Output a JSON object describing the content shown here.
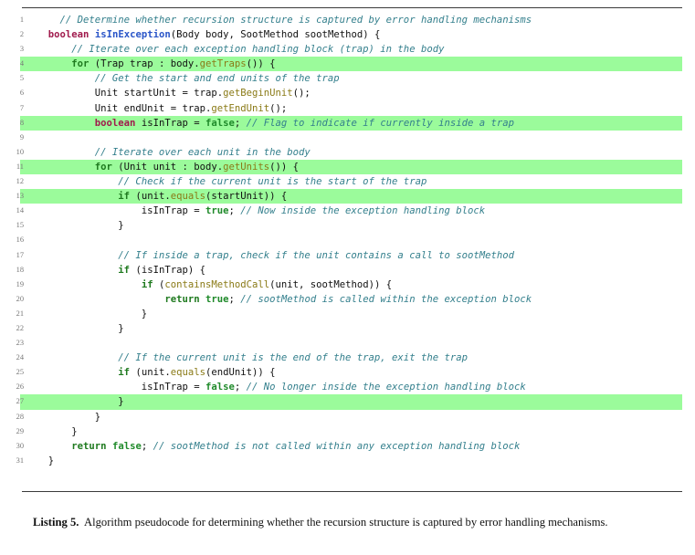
{
  "listing": {
    "label": "Listing 5.",
    "caption_text": "Algorithm pseudocode for determining whether the recursion structure is captured by error handling mechanisms.",
    "highlight_color": "#9bfb9b",
    "comment_color": "#337f8c",
    "keyword_color": "#a01a4c",
    "control_color": "#1f7a1f",
    "method_call_color": "#8a7a16",
    "declared_method_color": "#2a55c8",
    "literal_color": "#1f8a2a",
    "line_number_color": "#777777",
    "total_lines": 31,
    "lines": [
      {
        "n": "1",
        "highlight": false,
        "code": "    // Determine whether recursion structure is captured by error handling mechanisms"
      },
      {
        "n": "2",
        "highlight": false,
        "code": "  boolean isInException(Body body, SootMethod sootMethod) {"
      },
      {
        "n": "3",
        "highlight": false,
        "code": "      // Iterate over each exception handling block (trap) in the body"
      },
      {
        "n": "4",
        "highlight": true,
        "code": "      for (Trap trap : body.getTraps()) {"
      },
      {
        "n": "5",
        "highlight": false,
        "code": "          // Get the start and end units of the trap"
      },
      {
        "n": "6",
        "highlight": false,
        "code": "          Unit startUnit = trap.getBeginUnit();"
      },
      {
        "n": "7",
        "highlight": false,
        "code": "          Unit endUnit = trap.getEndUnit();"
      },
      {
        "n": "8",
        "highlight": true,
        "code": "          boolean isInTrap = false; // Flag to indicate if currently inside a trap"
      },
      {
        "n": "9",
        "highlight": false,
        "code": ""
      },
      {
        "n": "10",
        "highlight": false,
        "code": "          // Iterate over each unit in the body"
      },
      {
        "n": "11",
        "highlight": true,
        "code": "          for (Unit unit : body.getUnits()) {"
      },
      {
        "n": "12",
        "highlight": false,
        "code": "              // Check if the current unit is the start of the trap"
      },
      {
        "n": "13",
        "highlight": true,
        "code": "              if (unit.equals(startUnit)) {"
      },
      {
        "n": "14",
        "highlight": false,
        "code": "                  isInTrap = true; // Now inside the exception handling block"
      },
      {
        "n": "15",
        "highlight": false,
        "code": "              }"
      },
      {
        "n": "16",
        "highlight": false,
        "code": ""
      },
      {
        "n": "17",
        "highlight": false,
        "code": "              // If inside a trap, check if the unit contains a call to sootMethod"
      },
      {
        "n": "18",
        "highlight": false,
        "code": "              if (isInTrap) {"
      },
      {
        "n": "19",
        "highlight": false,
        "code": "                  if (containsMethodCall(unit, sootMethod)) {"
      },
      {
        "n": "20",
        "highlight": false,
        "code": "                      return true; // sootMethod is called within the exception block"
      },
      {
        "n": "21",
        "highlight": false,
        "code": "                  }"
      },
      {
        "n": "22",
        "highlight": false,
        "code": "              }"
      },
      {
        "n": "23",
        "highlight": false,
        "code": ""
      },
      {
        "n": "24",
        "highlight": false,
        "code": "              // If the current unit is the end of the trap, exit the trap"
      },
      {
        "n": "25",
        "highlight": false,
        "code": "              if (unit.equals(endUnit)) {"
      },
      {
        "n": "26",
        "highlight": false,
        "code": "                  isInTrap = false; // No longer inside the exception handling block"
      },
      {
        "n": "27",
        "highlight": true,
        "code": "              }"
      },
      {
        "n": "28",
        "highlight": false,
        "code": "          }"
      },
      {
        "n": "29",
        "highlight": false,
        "code": "      }"
      },
      {
        "n": "30",
        "highlight": false,
        "code": "      return false; // sootMethod is not called within any exception handling block"
      },
      {
        "n": "31",
        "highlight": false,
        "code": "  }"
      }
    ],
    "tokens": {
      "1": [
        [
          "cmt",
          "    // Determine whether recursion structure is captured by error handling mechanisms"
        ]
      ],
      "2": [
        [
          "plain",
          "  "
        ],
        [
          "kw",
          "boolean"
        ],
        [
          "plain",
          " "
        ],
        [
          "fn",
          "isInException"
        ],
        [
          "plain",
          "(Body body, SootMethod sootMethod) {"
        ]
      ],
      "3": [
        [
          "cmt",
          "      // Iterate over each exception handling block (trap) in the body"
        ]
      ],
      "4": [
        [
          "plain",
          "      "
        ],
        [
          "ctrl",
          "for"
        ],
        [
          "plain",
          " (Trap trap : body."
        ],
        [
          "call",
          "getTraps"
        ],
        [
          "plain",
          "()) {"
        ]
      ],
      "5": [
        [
          "cmt",
          "          // Get the start and end units of the trap"
        ]
      ],
      "6": [
        [
          "plain",
          "          Unit startUnit = trap."
        ],
        [
          "call",
          "getBeginUnit"
        ],
        [
          "plain",
          "();"
        ]
      ],
      "7": [
        [
          "plain",
          "          Unit endUnit = trap."
        ],
        [
          "call",
          "getEndUnit"
        ],
        [
          "plain",
          "();"
        ]
      ],
      "8": [
        [
          "plain",
          "          "
        ],
        [
          "kw",
          "boolean"
        ],
        [
          "plain",
          " isInTrap = "
        ],
        [
          "lit",
          "false"
        ],
        [
          "plain",
          "; "
        ],
        [
          "cmt",
          "// Flag to indicate if currently inside a trap"
        ]
      ],
      "9": [
        [
          "plain",
          ""
        ]
      ],
      "10": [
        [
          "cmt",
          "          // Iterate over each unit in the body"
        ]
      ],
      "11": [
        [
          "plain",
          "          "
        ],
        [
          "ctrl",
          "for"
        ],
        [
          "plain",
          " (Unit unit : body."
        ],
        [
          "call",
          "getUnits"
        ],
        [
          "plain",
          "()) {"
        ]
      ],
      "12": [
        [
          "cmt",
          "              // Check if the current unit is the start of the trap"
        ]
      ],
      "13": [
        [
          "plain",
          "              "
        ],
        [
          "ctrl",
          "if"
        ],
        [
          "plain",
          " (unit."
        ],
        [
          "call",
          "equals"
        ],
        [
          "plain",
          "(startUnit)) {"
        ]
      ],
      "14": [
        [
          "plain",
          "                  isInTrap = "
        ],
        [
          "lit",
          "true"
        ],
        [
          "plain",
          "; "
        ],
        [
          "cmt",
          "// Now inside the exception handling block"
        ]
      ],
      "15": [
        [
          "plain",
          "              }"
        ]
      ],
      "16": [
        [
          "plain",
          ""
        ]
      ],
      "17": [
        [
          "cmt",
          "              // If inside a trap, check if the unit contains a call to sootMethod"
        ]
      ],
      "18": [
        [
          "plain",
          "              "
        ],
        [
          "ctrl",
          "if"
        ],
        [
          "plain",
          " (isInTrap) {"
        ]
      ],
      "19": [
        [
          "plain",
          "                  "
        ],
        [
          "ctrl",
          "if"
        ],
        [
          "plain",
          " ("
        ],
        [
          "call",
          "containsMethodCall"
        ],
        [
          "plain",
          "(unit, sootMethod)) {"
        ]
      ],
      "20": [
        [
          "plain",
          "                      "
        ],
        [
          "ctrl",
          "return"
        ],
        [
          "plain",
          " "
        ],
        [
          "lit",
          "true"
        ],
        [
          "plain",
          "; "
        ],
        [
          "cmt",
          "// sootMethod is called within the exception block"
        ]
      ],
      "21": [
        [
          "plain",
          "                  }"
        ]
      ],
      "22": [
        [
          "plain",
          "              }"
        ]
      ],
      "23": [
        [
          "plain",
          ""
        ]
      ],
      "24": [
        [
          "cmt",
          "              // If the current unit is the end of the trap, exit the trap"
        ]
      ],
      "25": [
        [
          "plain",
          "              "
        ],
        [
          "ctrl",
          "if"
        ],
        [
          "plain",
          " (unit."
        ],
        [
          "call",
          "equals"
        ],
        [
          "plain",
          "(endUnit)) {"
        ]
      ],
      "26": [
        [
          "plain",
          "                  isInTrap = "
        ],
        [
          "lit",
          "false"
        ],
        [
          "plain",
          "; "
        ],
        [
          "cmt",
          "// No longer inside the exception handling block"
        ]
      ],
      "27": [
        [
          "plain",
          "              }"
        ]
      ],
      "28": [
        [
          "plain",
          "          }"
        ]
      ],
      "29": [
        [
          "plain",
          "      }"
        ]
      ],
      "30": [
        [
          "plain",
          "      "
        ],
        [
          "ctrl",
          "return"
        ],
        [
          "plain",
          " "
        ],
        [
          "lit",
          "false"
        ],
        [
          "plain",
          "; "
        ],
        [
          "cmt",
          "// sootMethod is not called within any exception handling block"
        ]
      ],
      "31": [
        [
          "plain",
          "  }"
        ]
      ]
    }
  }
}
